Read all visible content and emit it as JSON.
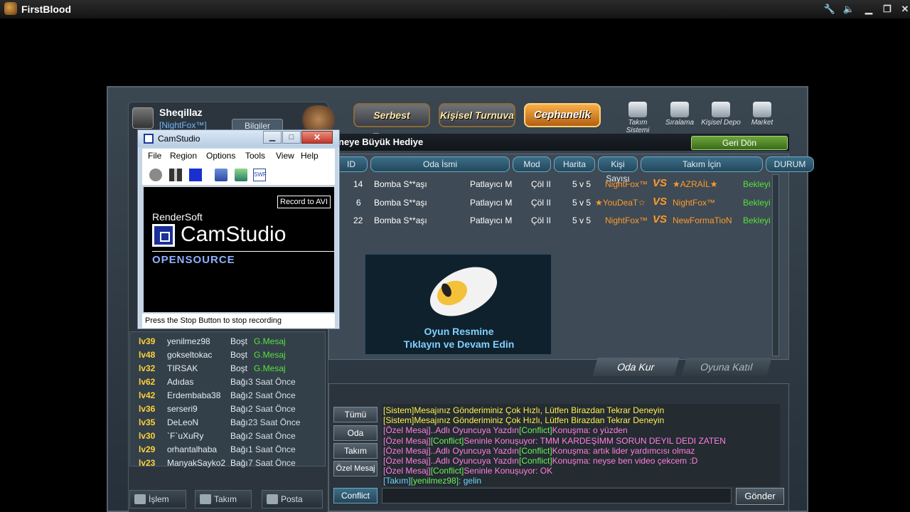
{
  "window": {
    "title": "FirstBlood",
    "controls": [
      "wrench-icon",
      "speaker-icon",
      "minimize-icon",
      "restore-icon",
      "close-icon"
    ]
  },
  "player": {
    "name": "Sheqillaz",
    "clan": "[NightFox™]",
    "info_button": "Bilgiler"
  },
  "top_tabs": [
    "Serbest Turnuva",
    "Kişisel Turnuva",
    "Cephanelik"
  ],
  "top_icons": [
    {
      "label": "Takım Sistemi",
      "icon": "team-icon"
    },
    {
      "label": "Sıralama",
      "icon": "ranking-icon"
    },
    {
      "label": "Kişisel Depo",
      "icon": "storage-icon"
    },
    {
      "label": "Market",
      "icon": "cart-icon"
    }
  ],
  "banner": {
    "text": "neye Büyük Hediye",
    "back_button": "Geri Dön"
  },
  "room_table": {
    "headers": [
      "ID",
      "Oda İsmi",
      "Mod",
      "Harita",
      "Kişi Sayısı",
      "Takım İçin",
      "DURUM"
    ],
    "rows": [
      {
        "id": "14",
        "name": "Bomba S**aşı",
        "mode": "Patlayıcı M",
        "map": "Çöl II",
        "size": "5 v 5",
        "team1": "NightFox™",
        "vs": "VS",
        "team2": "★AZRAİL★",
        "status": "Bekleyi"
      },
      {
        "id": "6",
        "name": "Bomba S**aşı",
        "mode": "Patlayıcı M",
        "map": "Çöl II",
        "size": "5 v 5",
        "team1": "★YouDeaT☆",
        "vs": "VS",
        "team2": "NightFox™",
        "status": "Bekleyi"
      },
      {
        "id": "22",
        "name": "Bomba S**aşı",
        "mode": "Patlayıcı M",
        "map": "Çöl II",
        "size": "5 v 5",
        "team1": "NightFox™",
        "vs": "VS",
        "team2": "NewFormaTioN",
        "status": "Bekleyi"
      }
    ]
  },
  "ad": {
    "line1": "Oyun Resmine",
    "line2": "Tıklayın ve Devam Edin"
  },
  "actions": {
    "create_room": "Oda Kur",
    "join_game": "Oyuna Katıl"
  },
  "chat": {
    "tabs": [
      "Tümü",
      "Oda",
      "Takım",
      "Özel Mesaj"
    ],
    "channel_button": "Conflict",
    "send_button": "Gönder",
    "lines": [
      [
        {
          "t": "[Sistem]Mesajınız Gönderiminiz Çok Hızlı, Lütfen Birazdan Tekrar Deneyin",
          "c": "yellow"
        }
      ],
      [
        {
          "t": "[Sistem]Mesajınız Gönderiminiz Çok Hızlı, Lütfen Birazdan Tekrar Deneyin",
          "c": "yellow"
        }
      ],
      [
        {
          "t": "[Özel Mesaj]",
          "c": "pink"
        },
        {
          "t": "..Adlı Oyuncuya Yazdın",
          "c": "pink"
        },
        {
          "t": "[Conflict]",
          "c": "lgreen"
        },
        {
          "t": "Konuşma: o yüzden",
          "c": "pink"
        }
      ],
      [
        {
          "t": "[Özel Mesaj]",
          "c": "pink"
        },
        {
          "t": "[Conflict]",
          "c": "lgreen"
        },
        {
          "t": "Seninle Konuşuyor: TMM KARDEŞİMM SORUN DEYIL DEDI ZATEN",
          "c": "pink"
        }
      ],
      [
        {
          "t": "[Özel Mesaj]",
          "c": "pink"
        },
        {
          "t": "..Adlı Oyuncuya Yazdın",
          "c": "pink"
        },
        {
          "t": "[Conflict]",
          "c": "lgreen"
        },
        {
          "t": "Konuşma: artık lider yardımcısı olmaz",
          "c": "pink"
        }
      ],
      [
        {
          "t": "[Özel Mesaj]",
          "c": "pink"
        },
        {
          "t": "..Adlı Oyuncuya Yazdın",
          "c": "pink"
        },
        {
          "t": "[Conflict]",
          "c": "lgreen"
        },
        {
          "t": "Konuşma: neyse ben video çekcem :D",
          "c": "pink"
        }
      ],
      [
        {
          "t": "[Özel Mesaj]",
          "c": "pink"
        },
        {
          "t": "[Conflict]",
          "c": "lgreen"
        },
        {
          "t": "Seninle Konuşuyor: OK",
          "c": "pink"
        }
      ],
      [
        {
          "t": "[Takım]",
          "c": "cyan"
        },
        {
          "t": "[yenilmez98]",
          "c": "lgreen"
        },
        {
          "t": ": gelin",
          "c": "cyan"
        }
      ]
    ]
  },
  "players": [
    {
      "lv": "lv39",
      "name": "yenilmez98",
      "state": "Boşt",
      "extra": "G.Mesaj",
      "extra_color": "green"
    },
    {
      "lv": "lv48",
      "name": "gokseltokac",
      "state": "Boşt",
      "extra": "G.Mesaj",
      "extra_color": "green"
    },
    {
      "lv": "lv32",
      "name": "TIRSAK",
      "state": "Boşt",
      "extra": "G.Mesaj",
      "extra_color": "green"
    },
    {
      "lv": "lv62",
      "name": "Adıdas",
      "state": "Bağı",
      "extra": "3 Saat Önce",
      "extra_color": "grey"
    },
    {
      "lv": "lv42",
      "name": "Erdembaba38",
      "state": "Bağı",
      "extra": "2 Saat Önce",
      "extra_color": "grey"
    },
    {
      "lv": "lv36",
      "name": "serseri9",
      "state": "Bağı",
      "extra": "2 Saat Önce",
      "extra_color": "grey"
    },
    {
      "lv": "lv35",
      "name": "DeLeoN",
      "state": "Bağı",
      "extra": "23 Saat Önce",
      "extra_color": "grey"
    },
    {
      "lv": "lv30",
      "name": "`F`uXuRy",
      "state": "Bağı",
      "extra": "2 Saat Önce",
      "extra_color": "grey"
    },
    {
      "lv": "lv29",
      "name": "orhantalhaba",
      "state": "Bağı",
      "extra": "1 Saat Önce",
      "extra_color": "grey"
    },
    {
      "lv": "lv23",
      "name": "ManyakSayko2",
      "state": "Bağı",
      "extra": "7 Saat Önce",
      "extra_color": "grey"
    }
  ],
  "bottom_nav": [
    "İşlem",
    "Takım",
    "Posta"
  ],
  "camstudio": {
    "title": "CamStudio",
    "menu": [
      "File",
      "Region",
      "Options",
      "Tools",
      "View",
      "Help"
    ],
    "record_label": "Record to AVI",
    "brand": "RenderSoft",
    "product": "CamStudio",
    "tagline": "OPENSOURCE",
    "status": "Press the Stop Button to stop recording"
  },
  "colors": {
    "accent_orange": "#ff9a2a",
    "status_green": "#58e13b",
    "level_yellow": "#ffd23a",
    "chat_pink": "#ff7fe0",
    "chat_yellow": "#fff04d"
  }
}
